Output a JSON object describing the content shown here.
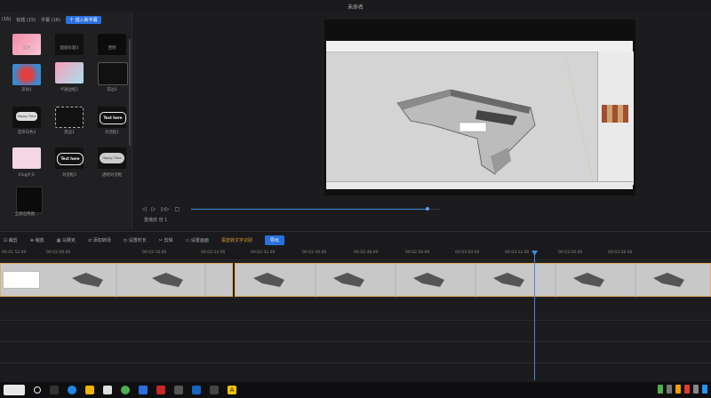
{
  "window": {
    "title": "未命名"
  },
  "left_panel": {
    "tabs": [
      {
        "label": "(16)"
      },
      {
        "label": "标题 (15)"
      },
      {
        "label": "字幕 (16)"
      }
    ],
    "add_button": "十 插入新字幕",
    "templates": [
      {
        "label": "蓝色"
      },
      {
        "label": "超级标题3"
      },
      {
        "label": "西侧"
      },
      {
        "label": "流动1"
      },
      {
        "label": "卡通边框1"
      },
      {
        "label": "花边1"
      },
      {
        "label": "选项白色3"
      },
      {
        "label": "黑边1"
      },
      {
        "label": "对话框1"
      },
      {
        "label": "Vlog片头"
      },
      {
        "label": "对话框5"
      },
      {
        "label": "透明对话框"
      },
      {
        "label": "全部后两图..."
      }
    ],
    "tile_texts": {
      "happy_time": "Happy Time",
      "text_here": "Text here"
    }
  },
  "preview": {
    "play_info": "重播放   倍 1"
  },
  "toolbar": {
    "items": [
      {
        "label": "裁剪"
      },
      {
        "label": "缩放"
      },
      {
        "label": "马赛克"
      },
      {
        "label": "添加转场"
      },
      {
        "label": "设置时长"
      },
      {
        "label": "剪辑"
      },
      {
        "label": "设置画面"
      }
    ],
    "voice_to_text": "语音转文字识别",
    "export": "导出"
  },
  "timeline": {
    "ticks": [
      "00:02:00.00",
      "00:02:16.00",
      "00:02:24.00",
      "00:02:32.00",
      "00:02:40.00",
      "00:02:48.00",
      "00:02:56.00",
      "00:03:04.00",
      "00:03:12.00",
      "00:03:20.00",
      "00:03:28.00"
    ],
    "first_tick": "00:01:52.00"
  },
  "colors": {
    "accent": "#2a6fe0",
    "clip_border": "#e0b060",
    "playhead": "#3f88d9"
  },
  "playback_progress": 0.95
}
